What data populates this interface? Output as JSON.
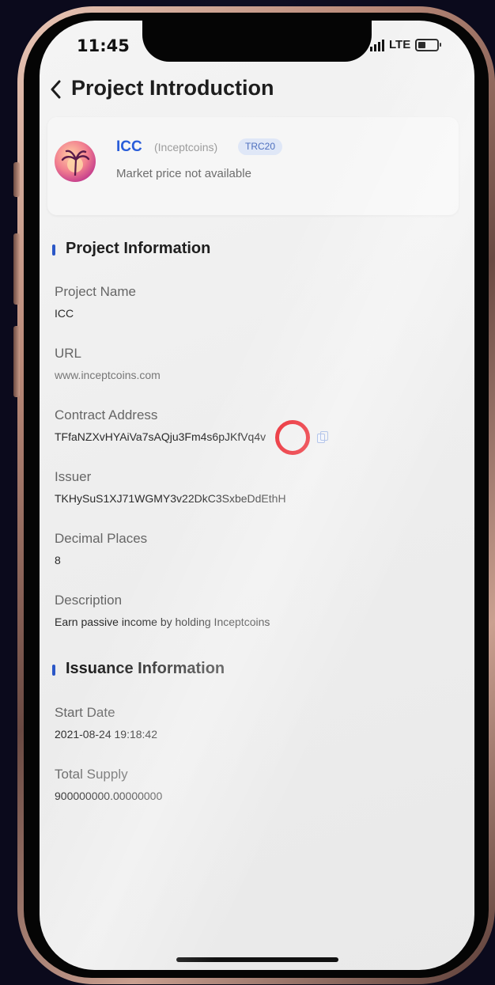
{
  "status": {
    "time": "11:45",
    "network": "LTE"
  },
  "header": {
    "title": "Project Introduction"
  },
  "token": {
    "symbol": "ICC",
    "full_name": "(Inceptcoins)",
    "standard": "TRC20",
    "price_text": "Market price not available"
  },
  "project_info": {
    "title": "Project Information",
    "fields": [
      {
        "label": "Project Name",
        "value": "ICC"
      },
      {
        "label": "URL",
        "value": "www.inceptcoins.com"
      },
      {
        "label": "Contract Address",
        "value": "TFfaNZXvHYAiVa7sAQju3Fm4s6pJKfVq4v"
      },
      {
        "label": "Issuer",
        "value": "TKHySuS1XJ71WGMY3v22DkC3SxbeDdEthH"
      },
      {
        "label": "Decimal Places",
        "value": "8"
      },
      {
        "label": "Description",
        "value": "Earn passive income by holding Inceptcoins"
      }
    ]
  },
  "issuance_info": {
    "title": "Issuance Information",
    "fields": [
      {
        "label": "Start Date",
        "value": "2021-08-24 19:18:42"
      },
      {
        "label": "Total Supply",
        "value": "900000000.00000000"
      }
    ]
  },
  "icons": {
    "back": "chevron-left-icon",
    "copy": "copy-icon",
    "signal": "signal-icon",
    "battery": "battery-icon"
  },
  "colors": {
    "accent": "#2b57c7",
    "token_symbol": "#2a5dd9",
    "annotation": "#e8101a"
  }
}
